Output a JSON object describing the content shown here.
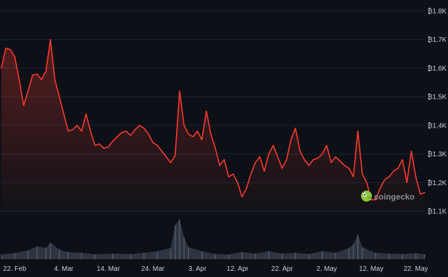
{
  "watermark": {
    "text": "coingecko",
    "icon": "gecko-logo-icon"
  },
  "colors": {
    "background": "#0d1117",
    "price_line": "#ff3b30",
    "volume_fill": "#3a4250",
    "grid": "#1f2630",
    "tick_text": "#c9ced6",
    "logo": "#8dc63f"
  },
  "chart_data": {
    "type": "line",
    "title": "",
    "xlabel": "",
    "ylabel": "",
    "y_axis_side": "right",
    "grid": "horizontal",
    "ylim": [
      1050,
      1800
    ],
    "xlim": [
      "2024-02-19",
      "2024-05-24"
    ],
    "y_ticks": [
      "₿1.1K",
      "₿1.2K",
      "₿1.3K",
      "₿1.4K",
      "₿1.5K",
      "₿1.6K",
      "₿1.7K",
      "₿1.8K"
    ],
    "y_tick_values": [
      1100,
      1200,
      1300,
      1400,
      1500,
      1600,
      1700,
      1800
    ],
    "x_ticks": [
      "22. Feb",
      "4. Mar",
      "14. Mar",
      "24. Mar",
      "3. Apr",
      "12. Apr",
      "22. Apr",
      "2. May",
      "12. May",
      "22. May"
    ],
    "x_tick_dates": [
      "2024-02-22",
      "2024-03-04",
      "2024-03-14",
      "2024-03-24",
      "2024-04-03",
      "2024-04-12",
      "2024-04-22",
      "2024-05-02",
      "2024-05-12",
      "2024-05-22"
    ],
    "series": [
      {
        "kind": "price",
        "points": [
          [
            "2024-02-19",
            1600
          ],
          [
            "2024-02-20",
            1670
          ],
          [
            "2024-02-21",
            1665
          ],
          [
            "2024-02-22",
            1640
          ],
          [
            "2024-02-23",
            1560
          ],
          [
            "2024-02-24",
            1470
          ],
          [
            "2024-02-25",
            1520
          ],
          [
            "2024-02-26",
            1575
          ],
          [
            "2024-02-27",
            1580
          ],
          [
            "2024-02-28",
            1560
          ],
          [
            "2024-02-29",
            1590
          ],
          [
            "2024-03-01",
            1700
          ],
          [
            "2024-03-02",
            1560
          ],
          [
            "2024-03-03",
            1500
          ],
          [
            "2024-03-04",
            1440
          ],
          [
            "2024-03-05",
            1380
          ],
          [
            "2024-03-06",
            1385
          ],
          [
            "2024-03-07",
            1400
          ],
          [
            "2024-03-08",
            1380
          ],
          [
            "2024-03-09",
            1440
          ],
          [
            "2024-03-10",
            1380
          ],
          [
            "2024-03-11",
            1330
          ],
          [
            "2024-03-12",
            1335
          ],
          [
            "2024-03-13",
            1320
          ],
          [
            "2024-03-14",
            1325
          ],
          [
            "2024-03-15",
            1345
          ],
          [
            "2024-03-16",
            1360
          ],
          [
            "2024-03-17",
            1375
          ],
          [
            "2024-03-18",
            1380
          ],
          [
            "2024-03-19",
            1365
          ],
          [
            "2024-03-20",
            1385
          ],
          [
            "2024-03-21",
            1400
          ],
          [
            "2024-03-22",
            1390
          ],
          [
            "2024-03-23",
            1370
          ],
          [
            "2024-03-24",
            1340
          ],
          [
            "2024-03-25",
            1330
          ],
          [
            "2024-03-26",
            1310
          ],
          [
            "2024-03-27",
            1290
          ],
          [
            "2024-03-28",
            1270
          ],
          [
            "2024-03-29",
            1295
          ],
          [
            "2024-03-30",
            1520
          ],
          [
            "2024-03-31",
            1400
          ],
          [
            "2024-04-01",
            1370
          ],
          [
            "2024-04-02",
            1360
          ],
          [
            "2024-04-03",
            1380
          ],
          [
            "2024-04-04",
            1350
          ],
          [
            "2024-04-05",
            1450
          ],
          [
            "2024-04-06",
            1370
          ],
          [
            "2024-04-07",
            1320
          ],
          [
            "2024-04-08",
            1260
          ],
          [
            "2024-04-09",
            1280
          ],
          [
            "2024-04-10",
            1220
          ],
          [
            "2024-04-11",
            1230
          ],
          [
            "2024-04-12",
            1200
          ],
          [
            "2024-04-13",
            1150
          ],
          [
            "2024-04-14",
            1180
          ],
          [
            "2024-04-15",
            1230
          ],
          [
            "2024-04-16",
            1270
          ],
          [
            "2024-04-17",
            1290
          ],
          [
            "2024-04-18",
            1240
          ],
          [
            "2024-04-19",
            1300
          ],
          [
            "2024-04-20",
            1330
          ],
          [
            "2024-04-21",
            1290
          ],
          [
            "2024-04-22",
            1250
          ],
          [
            "2024-04-23",
            1280
          ],
          [
            "2024-04-24",
            1350
          ],
          [
            "2024-04-25",
            1390
          ],
          [
            "2024-04-26",
            1310
          ],
          [
            "2024-04-27",
            1280
          ],
          [
            "2024-04-28",
            1260
          ],
          [
            "2024-04-29",
            1280
          ],
          [
            "2024-04-30",
            1285
          ],
          [
            "2024-05-01",
            1300
          ],
          [
            "2024-05-02",
            1330
          ],
          [
            "2024-05-03",
            1270
          ],
          [
            "2024-05-04",
            1290
          ],
          [
            "2024-05-05",
            1275
          ],
          [
            "2024-05-06",
            1260
          ],
          [
            "2024-05-07",
            1250
          ],
          [
            "2024-05-08",
            1220
          ],
          [
            "2024-05-09",
            1380
          ],
          [
            "2024-05-10",
            1230
          ],
          [
            "2024-05-11",
            1200
          ],
          [
            "2024-05-12",
            1140
          ],
          [
            "2024-05-13",
            1140
          ],
          [
            "2024-05-14",
            1180
          ],
          [
            "2024-05-15",
            1210
          ],
          [
            "2024-05-16",
            1220
          ],
          [
            "2024-05-17",
            1240
          ],
          [
            "2024-05-18",
            1250
          ],
          [
            "2024-05-19",
            1280
          ],
          [
            "2024-05-20",
            1200
          ],
          [
            "2024-05-21",
            1310
          ],
          [
            "2024-05-22",
            1220
          ],
          [
            "2024-05-23",
            1160
          ],
          [
            "2024-05-24",
            1165
          ]
        ]
      },
      {
        "kind": "volume",
        "relative": true,
        "points": [
          [
            "2024-02-19",
            0.12
          ],
          [
            "2024-02-22",
            0.15
          ],
          [
            "2024-02-25",
            0.22
          ],
          [
            "2024-02-27",
            0.32
          ],
          [
            "2024-02-29",
            0.28
          ],
          [
            "2024-03-01",
            0.42
          ],
          [
            "2024-03-03",
            0.24
          ],
          [
            "2024-03-05",
            0.18
          ],
          [
            "2024-03-08",
            0.16
          ],
          [
            "2024-03-11",
            0.12
          ],
          [
            "2024-03-15",
            0.14
          ],
          [
            "2024-03-19",
            0.13
          ],
          [
            "2024-03-22",
            0.16
          ],
          [
            "2024-03-25",
            0.2
          ],
          [
            "2024-03-28",
            0.28
          ],
          [
            "2024-03-29",
            0.85
          ],
          [
            "2024-03-30",
            1.0
          ],
          [
            "2024-03-31",
            0.55
          ],
          [
            "2024-04-01",
            0.3
          ],
          [
            "2024-04-04",
            0.2
          ],
          [
            "2024-04-07",
            0.13
          ],
          [
            "2024-04-10",
            0.12
          ],
          [
            "2024-04-13",
            0.18
          ],
          [
            "2024-04-16",
            0.14
          ],
          [
            "2024-04-19",
            0.2
          ],
          [
            "2024-04-22",
            0.14
          ],
          [
            "2024-04-25",
            0.16
          ],
          [
            "2024-04-28",
            0.13
          ],
          [
            "2024-05-01",
            0.2
          ],
          [
            "2024-05-04",
            0.16
          ],
          [
            "2024-05-07",
            0.28
          ],
          [
            "2024-05-08",
            0.38
          ],
          [
            "2024-05-09",
            0.62
          ],
          [
            "2024-05-10",
            0.3
          ],
          [
            "2024-05-13",
            0.16
          ],
          [
            "2024-05-16",
            0.14
          ],
          [
            "2024-05-19",
            0.13
          ],
          [
            "2024-05-22",
            0.15
          ],
          [
            "2024-05-24",
            0.12
          ]
        ]
      }
    ]
  }
}
